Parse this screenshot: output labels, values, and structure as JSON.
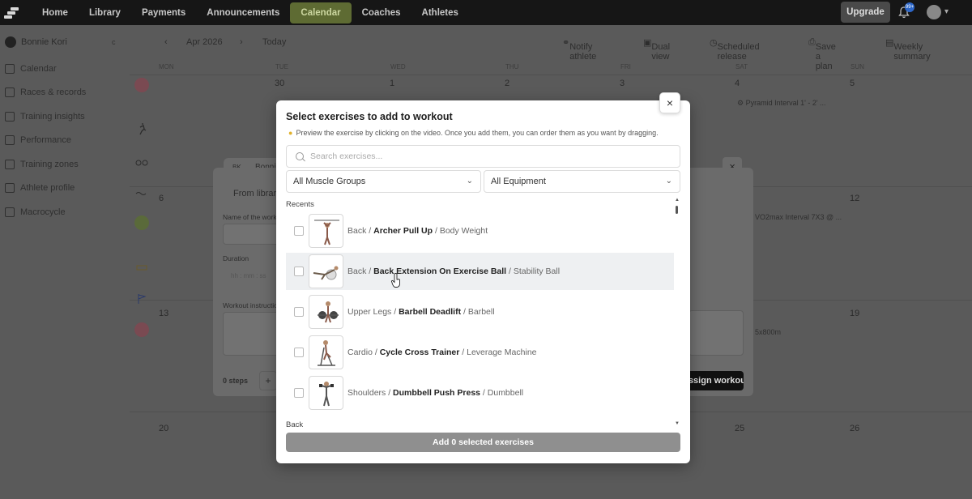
{
  "nav": {
    "items": [
      "Home",
      "Library",
      "Payments",
      "Announcements",
      "Calendar",
      "Coaches",
      "Athletes"
    ],
    "active_index": 4,
    "upgrade_label": "Upgrade",
    "notification_badge": "99+"
  },
  "sidebar": {
    "athlete_name": "Bonnie Kori",
    "athlete_suffix": "c",
    "items": [
      "Calendar",
      "Races & records",
      "Training insights",
      "Performance",
      "Training zones",
      "Athlete profile",
      "Macrocycle"
    ]
  },
  "calendar": {
    "month": "Apr 2026",
    "today_label": "Today",
    "actions": [
      "Notify athlete",
      "Dual view",
      "Scheduled release",
      "Save a plan",
      "Weekly summary"
    ],
    "day_names": [
      "MON",
      "TUE",
      "WED",
      "THU",
      "FRI",
      "SAT",
      "SUN"
    ],
    "week1_numbers": [
      "30",
      "31",
      "1",
      "2",
      "3",
      "4",
      "5"
    ],
    "week2_numbers": [
      "6",
      "12"
    ],
    "week3_numbers": [
      "13",
      "19"
    ],
    "week4_numbers": [
      "20",
      "25",
      "26"
    ],
    "chips": [
      "Pyramid Interval 1' - 2' ...",
      "VO2max Interval 7X3 @ ...",
      "5x800m"
    ]
  },
  "bg_dialog": {
    "initials": "BK",
    "name": "Bonnie",
    "tab_library": "From library",
    "name_label": "Name of the workout",
    "duration_label": "Duration",
    "duration_placeholder": "hh : mm : ss",
    "instructions_label": "Workout instructions",
    "steps_label": "0 steps",
    "assign_label": "Assign workout"
  },
  "modal": {
    "title": "Select exercises to add to workout",
    "hint": "Preview the exercise by clicking on the video. Once you add them, you can order them as you want by dragging.",
    "search_placeholder": "Search exercises...",
    "muscle_filter": "All Muscle Groups",
    "equipment_filter": "All Equipment",
    "section_recents": "Recents",
    "section_back": "Back",
    "add_button": "Add 0 selected exercises",
    "exercises": [
      {
        "group": "Back",
        "name": "Archer Pull Up",
        "equipment": "Body Weight"
      },
      {
        "group": "Back",
        "name": "Back Extension On Exercise Ball",
        "equipment": "Stability Ball"
      },
      {
        "group": "Upper Legs",
        "name": "Barbell Deadlift",
        "equipment": "Barbell"
      },
      {
        "group": "Cardio",
        "name": "Cycle Cross Trainer",
        "equipment": "Leverage Machine"
      },
      {
        "group": "Shoulders",
        "name": "Dumbbell Push Press",
        "equipment": "Dumbbell"
      }
    ]
  }
}
